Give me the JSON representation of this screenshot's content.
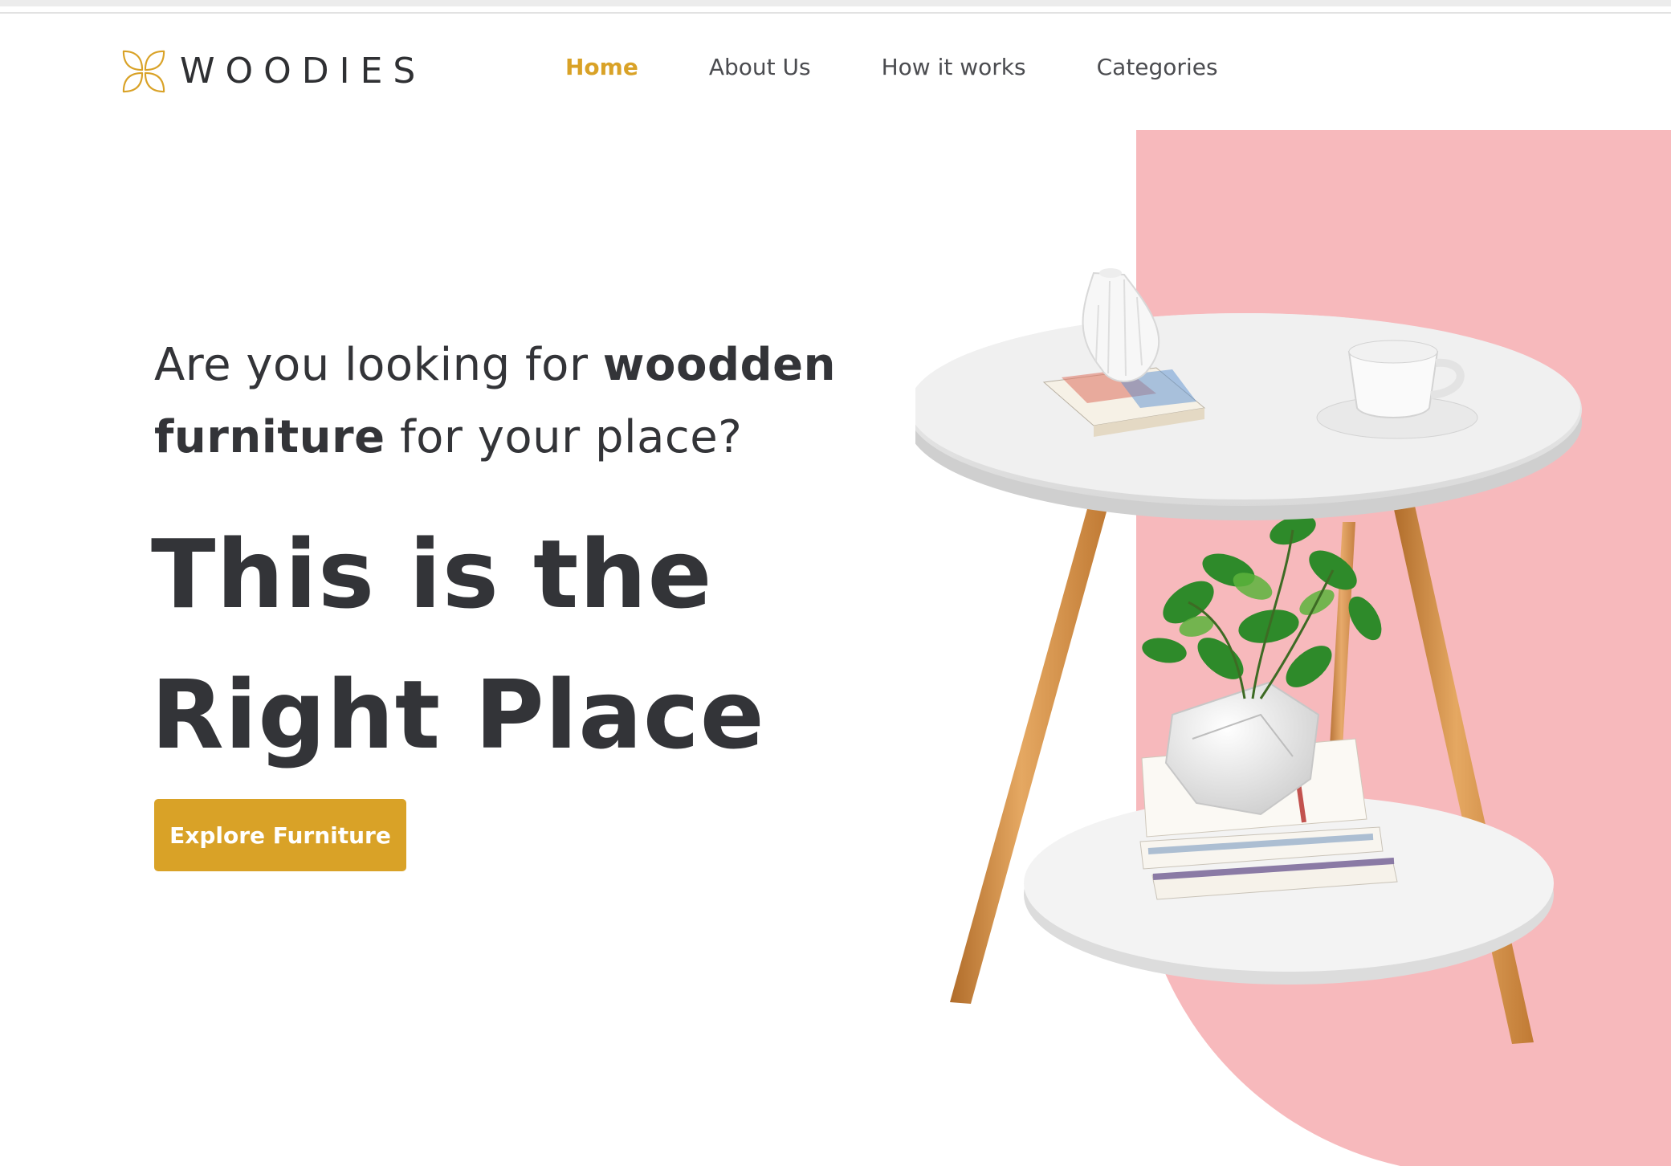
{
  "brand": {
    "name": "WOODIES",
    "accent_color": "#d9a227",
    "icon": "four-petal-logo-icon"
  },
  "nav": {
    "items": [
      {
        "label": "Home",
        "active": true
      },
      {
        "label": "About Us",
        "active": false
      },
      {
        "label": "How it works",
        "active": false
      },
      {
        "label": "Categories",
        "active": false
      }
    ]
  },
  "hero": {
    "question_part1": "Are you looking for ",
    "question_bold1": "woodden",
    "question_bold2": "furniture",
    "question_part2": " for your place?",
    "title_line1": "This is the",
    "title_line2": "Right Place",
    "cta_label": "Explore Furniture",
    "panel_color": "#f7b9bc",
    "image": "side-table-with-plant-illustration"
  }
}
